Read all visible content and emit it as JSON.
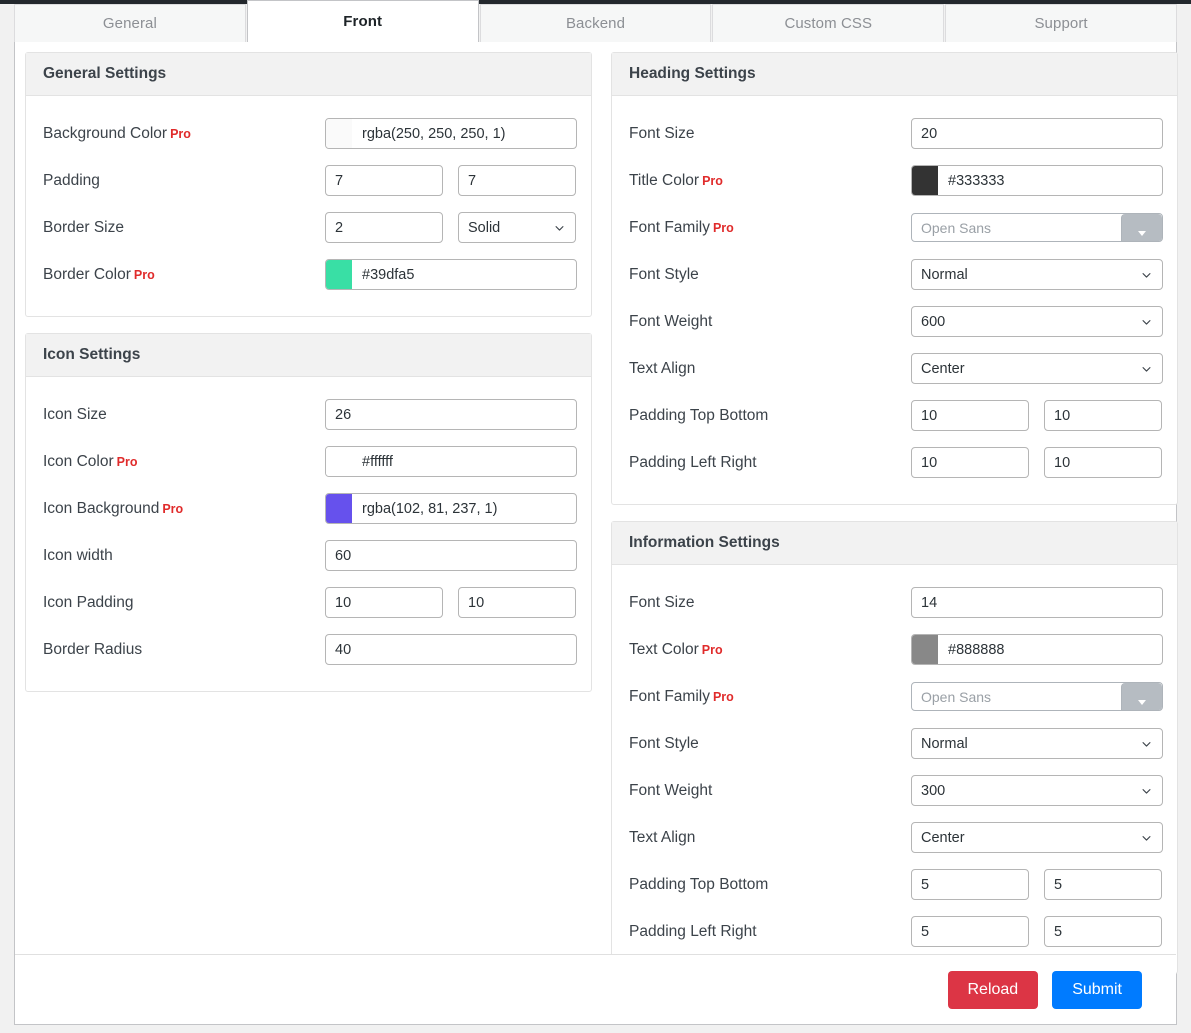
{
  "tabs": [
    {
      "label": "General",
      "active": false
    },
    {
      "label": "Front",
      "active": true
    },
    {
      "label": "Backend",
      "active": false
    },
    {
      "label": "Custom CSS",
      "active": false
    },
    {
      "label": "Support",
      "active": false
    }
  ],
  "pro_badge": "Pro",
  "colors": {
    "pro_red": "#e02b2b",
    "reload_button": "#dc3545",
    "submit_button": "#007bff",
    "background_color_swatch": "#fafafa",
    "border_color_swatch": "#39dfa5",
    "icon_color_swatch": "#ffffff",
    "icon_background_swatch": "#6651ed",
    "title_color_swatch": "#333333",
    "text_color_swatch": "#888888"
  },
  "sections": {
    "general": {
      "title": "General Settings",
      "background_color": {
        "label": "Background Color",
        "pro": true,
        "value": "rgba(250, 250, 250, 1)",
        "swatch": "#fafafa"
      },
      "padding": {
        "label": "Padding",
        "pro": false,
        "value1": "7",
        "value2": "7"
      },
      "border_size": {
        "label": "Border Size",
        "pro": false,
        "value": "2",
        "style": "Solid"
      },
      "border_color": {
        "label": "Border Color",
        "pro": true,
        "value": "#39dfa5",
        "swatch": "#39dfa5"
      }
    },
    "icon": {
      "title": "Icon Settings",
      "icon_size": {
        "label": "Icon Size",
        "pro": false,
        "value": "26"
      },
      "icon_color": {
        "label": "Icon Color",
        "pro": true,
        "value": "#ffffff",
        "swatch": "#ffffff"
      },
      "icon_background": {
        "label": "Icon Background",
        "pro": true,
        "value": "rgba(102, 81, 237, 1)",
        "swatch": "#6651ed"
      },
      "icon_width": {
        "label": "Icon width",
        "pro": false,
        "value": "60"
      },
      "icon_padding": {
        "label": "Icon Padding",
        "pro": false,
        "value1": "10",
        "value2": "10"
      },
      "border_radius": {
        "label": "Border Radius",
        "pro": false,
        "value": "40"
      }
    },
    "heading": {
      "title": "Heading Settings",
      "font_size": {
        "label": "Font Size",
        "pro": false,
        "value": "20"
      },
      "title_color": {
        "label": "Title Color",
        "pro": true,
        "value": "#333333",
        "swatch": "#333333"
      },
      "font_family": {
        "label": "Font Family",
        "pro": true,
        "value": "Open Sans"
      },
      "font_style": {
        "label": "Font Style",
        "pro": false,
        "value": "Normal"
      },
      "font_weight": {
        "label": "Font Weight",
        "pro": false,
        "value": "600"
      },
      "text_align": {
        "label": "Text Align",
        "pro": false,
        "value": "Center"
      },
      "padding_top_bottom": {
        "label": "Padding Top Bottom",
        "pro": false,
        "value1": "10",
        "value2": "10"
      },
      "padding_left_right": {
        "label": "Padding Left Right",
        "pro": false,
        "value1": "10",
        "value2": "10"
      }
    },
    "information": {
      "title": "Information Settings",
      "font_size": {
        "label": "Font Size",
        "pro": false,
        "value": "14"
      },
      "text_color": {
        "label": "Text Color",
        "pro": true,
        "value": "#888888",
        "swatch": "#888888"
      },
      "font_family": {
        "label": "Font Family",
        "pro": true,
        "value": "Open Sans"
      },
      "font_style": {
        "label": "Font Style",
        "pro": false,
        "value": "Normal"
      },
      "font_weight": {
        "label": "Font Weight",
        "pro": false,
        "value": "300"
      },
      "text_align": {
        "label": "Text Align",
        "pro": false,
        "value": "Center"
      },
      "padding_top_bottom": {
        "label": "Padding Top Bottom",
        "pro": false,
        "value1": "5",
        "value2": "5"
      },
      "padding_left_right": {
        "label": "Padding Left Right",
        "pro": false,
        "value1": "5",
        "value2": "5"
      }
    }
  },
  "footer": {
    "reload_label": "Reload",
    "submit_label": "Submit"
  }
}
